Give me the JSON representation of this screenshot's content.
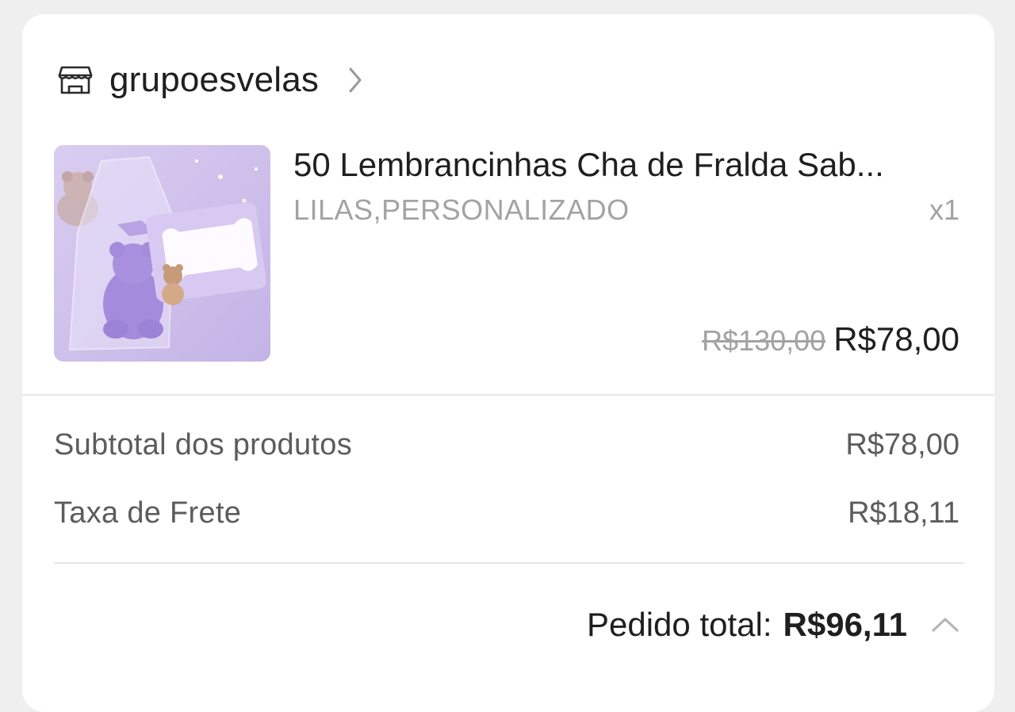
{
  "store": {
    "name": "grupoesvelas",
    "icon": "store-icon"
  },
  "product": {
    "title": "50 Lembrancinhas Cha de Fralda Sab...",
    "variant": "LILAS,PERSONALIZADO",
    "quantity": "x1",
    "price_original": "R$130,00",
    "price_current": "R$78,00",
    "image_colors": {
      "background": "#cfc1ea",
      "accent": "#b49ddf"
    }
  },
  "summary": {
    "subtotal_label": "Subtotal dos produtos",
    "subtotal_value": "R$78,00",
    "shipping_label": "Taxa de Frete",
    "shipping_value": "R$18,11"
  },
  "total": {
    "label": "Pedido total:",
    "value": "R$96,11",
    "toggle_icon": "chevron-up-icon"
  }
}
